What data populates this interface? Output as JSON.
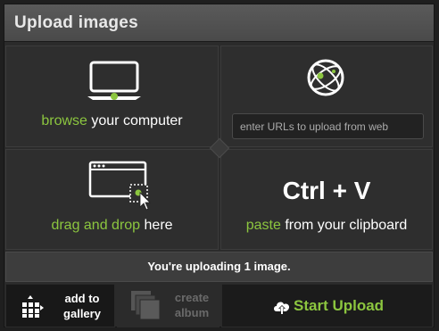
{
  "header": {
    "title": "Upload images"
  },
  "browse": {
    "highlight": "browse",
    "rest": " your computer",
    "icon": "monitor-icon"
  },
  "url": {
    "placeholder": "enter URLs to upload from web",
    "icon": "globe-icon"
  },
  "drag": {
    "highlight": "drag and drop",
    "rest": " here",
    "icon": "browser-window-drop-icon"
  },
  "paste": {
    "shortcut": "Ctrl + V",
    "highlight": "paste",
    "rest": " from your clipboard"
  },
  "status": {
    "text": "You're uploading 1 image."
  },
  "buttons": {
    "add_to_gallery": {
      "line1": "add to",
      "line2": "gallery",
      "icon": "add-to-gallery-grid-icon"
    },
    "create_album": {
      "line1": "create",
      "line2": "album",
      "icon": "stacked-album-icon",
      "enabled": false
    },
    "start_upload": {
      "label": "Start Upload",
      "icon": "cloud-upload-icon"
    }
  },
  "colors": {
    "accent": "#8cc63f",
    "background": "#2b2b2b",
    "header": "#4f4f4f"
  }
}
